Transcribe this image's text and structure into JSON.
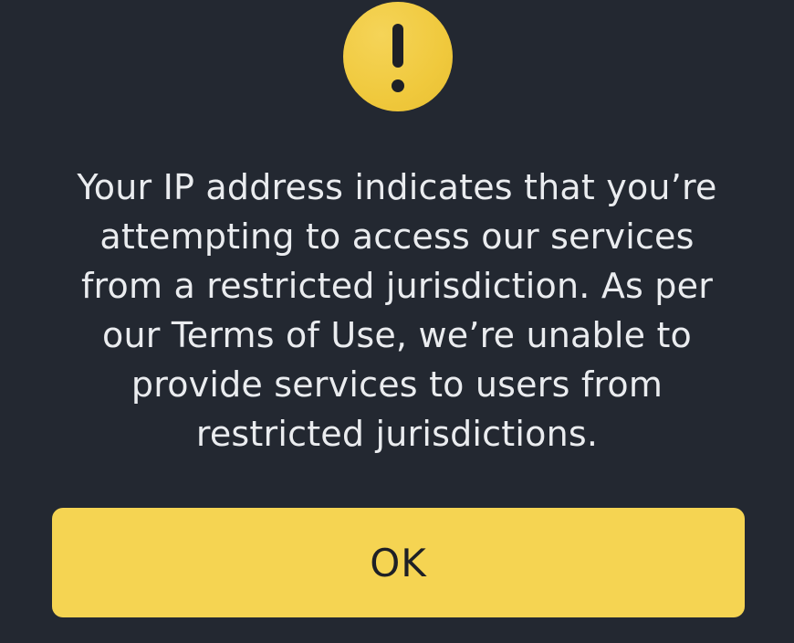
{
  "dialog": {
    "icon": "exclamation-warning-icon",
    "accent_color": "#F0C93D",
    "message": "Your IP address indicates that you’re attempting to access our services from a restricted jurisdiction. As per our Terms of Use, we’re unable to provide services to users from restricted jurisdictions.",
    "ok_label": "OK"
  }
}
